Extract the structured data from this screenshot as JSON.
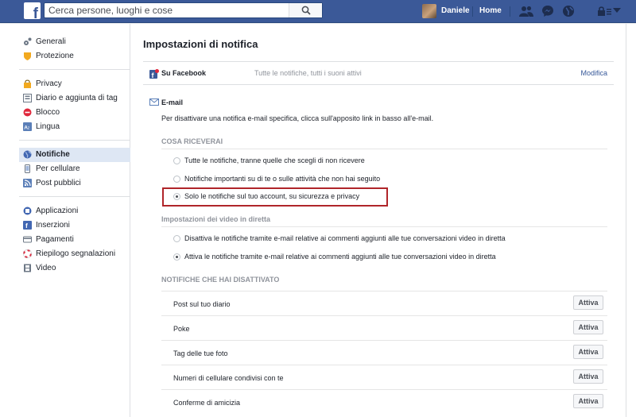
{
  "topbar": {
    "logo": "f",
    "search_placeholder": "Cerca persone, luoghi e cose",
    "user_name": "Daniele",
    "home_label": "Home",
    "icons": [
      "friends-icon",
      "messenger-icon",
      "globe-icon",
      "lock-icon",
      "chevron-down-icon"
    ]
  },
  "sidebar": {
    "groups": [
      [
        {
          "label": "Generali",
          "icon": "gear-icon"
        },
        {
          "label": "Protezione",
          "icon": "shield-icon"
        }
      ],
      [
        {
          "label": "Privacy",
          "icon": "lock-icon"
        },
        {
          "label": "Diario e aggiunta di tag",
          "icon": "timeline-icon"
        },
        {
          "label": "Blocco",
          "icon": "block-icon"
        },
        {
          "label": "Lingua",
          "icon": "language-icon"
        }
      ],
      [
        {
          "label": "Notifiche",
          "icon": "globe-icon",
          "active": true
        },
        {
          "label": "Per cellulare",
          "icon": "mobile-icon"
        },
        {
          "label": "Post pubblici",
          "icon": "rss-icon"
        }
      ],
      [
        {
          "label": "Applicazioni",
          "icon": "apps-icon"
        },
        {
          "label": "Inserzioni",
          "icon": "ads-icon"
        },
        {
          "label": "Pagamenti",
          "icon": "card-icon"
        },
        {
          "label": "Riepilogo segnalazioni",
          "icon": "lifebuoy-icon"
        },
        {
          "label": "Video",
          "icon": "film-icon"
        }
      ]
    ]
  },
  "main": {
    "title": "Impostazioni di notifica",
    "on_facebook": {
      "label": "Su Facebook",
      "value": "Tutte le notifiche, tutti i suoni attivi",
      "edit": "Modifica"
    },
    "email": {
      "label": "E-mail",
      "description": "Per disattivare una notifica e-mail specifica, clicca sull'apposito link in basso all'e-mail.",
      "receive_heading": "COSA RICEVERAI",
      "receive_options": [
        {
          "label": "Tutte le notifiche, tranne quelle che scegli di non ricevere",
          "selected": false
        },
        {
          "label": "Notifiche importanti su di te o sulle attività che non hai seguito",
          "selected": false
        },
        {
          "label": "Solo le notifiche sul tuo account, su sicurezza e privacy",
          "selected": true
        }
      ],
      "live_heading": "Impostazioni dei video in diretta",
      "live_options": [
        {
          "label": "Disattiva le notifiche tramite e-mail relative ai commenti aggiunti alle tue conversazioni video in diretta",
          "selected": false
        },
        {
          "label": "Attiva le notifiche tramite e-mail relative ai commenti aggiunti alle tue conversazioni video in diretta",
          "selected": true
        }
      ],
      "disabled_heading": "NOTIFICHE CHE HAI DISATTIVATO",
      "disabled_items": [
        {
          "label": "Post sul tuo diario",
          "button": "Attiva"
        },
        {
          "label": "Poke",
          "button": "Attiva"
        },
        {
          "label": "Tag delle tue foto",
          "button": "Attiva"
        },
        {
          "label": "Numeri di cellulare condivisi con te",
          "button": "Attiva"
        },
        {
          "label": "Conferme di amicizia",
          "button": "Attiva"
        }
      ]
    }
  },
  "colors": {
    "brand": "#3b5998",
    "highlight": "#b0252a",
    "link": "#365899"
  }
}
